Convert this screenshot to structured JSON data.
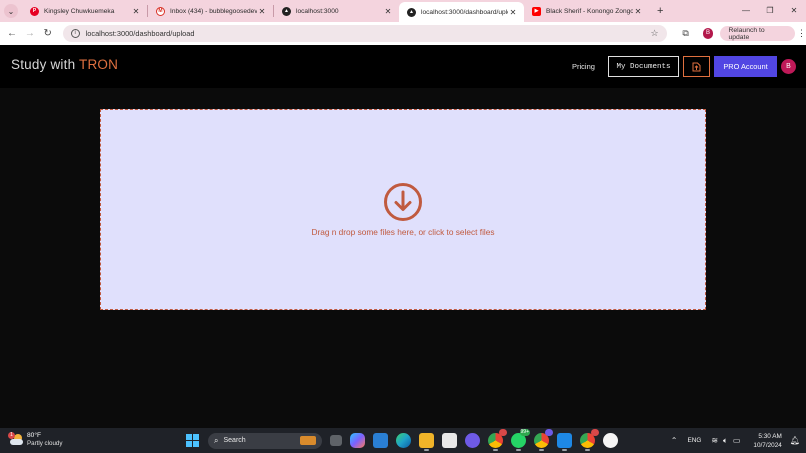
{
  "browser": {
    "tabs": [
      {
        "title": "Kingsley Chuwkuemeka",
        "favicon": "pinterest-icon",
        "color": "#e60023",
        "active": false
      },
      {
        "title": "Inbox (434) - bubblegoosedev",
        "favicon": "gmail-icon",
        "color": "#d93025",
        "active": false
      },
      {
        "title": "localhost:3000",
        "favicon": "app-triangle-icon",
        "color": "#222222",
        "active": false
      },
      {
        "title": "localhost:3000/dashboard/upload",
        "favicon": "app-triangle-icon",
        "color": "#222222",
        "active": true
      },
      {
        "title": "Black Sherif - Konongo Zongo",
        "favicon": "youtube-icon",
        "color": "#ff0000",
        "active": false
      }
    ],
    "url": "localhost:3000/dashboard/upload",
    "profile_initial": "B",
    "relaunch_label": "Relaunch to update"
  },
  "app": {
    "brand_prefix": "Study with ",
    "brand_accent": "TRON",
    "accent_color": "#e0703f",
    "nav": {
      "pricing": "Pricing",
      "my_documents": "My Documents",
      "pro_account": "PRO Account",
      "avatar_initial": "B"
    },
    "upload": {
      "hint": "Drag n drop some files here, or click to select files",
      "icon": "download-circle-icon"
    }
  },
  "taskbar": {
    "weather": {
      "temp": "80°F",
      "condition": "Partly cloudy",
      "alert_count": "1"
    },
    "search_label": "Search",
    "apps": [
      {
        "name": "task-view-icon",
        "color": "#5f6368",
        "running": false
      },
      {
        "name": "copilot-icon",
        "color": "#7b61ff",
        "running": false
      },
      {
        "name": "mail-icon",
        "color": "#2a7fd4",
        "running": false
      },
      {
        "name": "edge-icon",
        "color": "#1fa3c9",
        "running": false
      },
      {
        "name": "file-explorer-icon",
        "color": "#f0b429",
        "running": true
      },
      {
        "name": "store-icon",
        "color": "#e8e8e8",
        "running": false
      },
      {
        "name": "media-player-icon",
        "color": "#6e5ae6",
        "running": false
      },
      {
        "name": "chrome-icon",
        "color": "#4285f4",
        "running": true,
        "badge": ""
      },
      {
        "name": "whatsapp-icon",
        "color": "#25d366",
        "running": true,
        "badge": "99+"
      },
      {
        "name": "chrome-profile-icon",
        "color": "#34a853",
        "running": true,
        "badge": ""
      },
      {
        "name": "vscode-icon",
        "color": "#1e88e5",
        "running": true
      },
      {
        "name": "chrome-active-icon",
        "color": "#ea4335",
        "running": true,
        "badge": ""
      },
      {
        "name": "itunes-icon",
        "color": "#f5f5f5",
        "running": false
      }
    ],
    "lang": "ENG",
    "time": "5:30 AM",
    "date": "10/7/2024"
  }
}
